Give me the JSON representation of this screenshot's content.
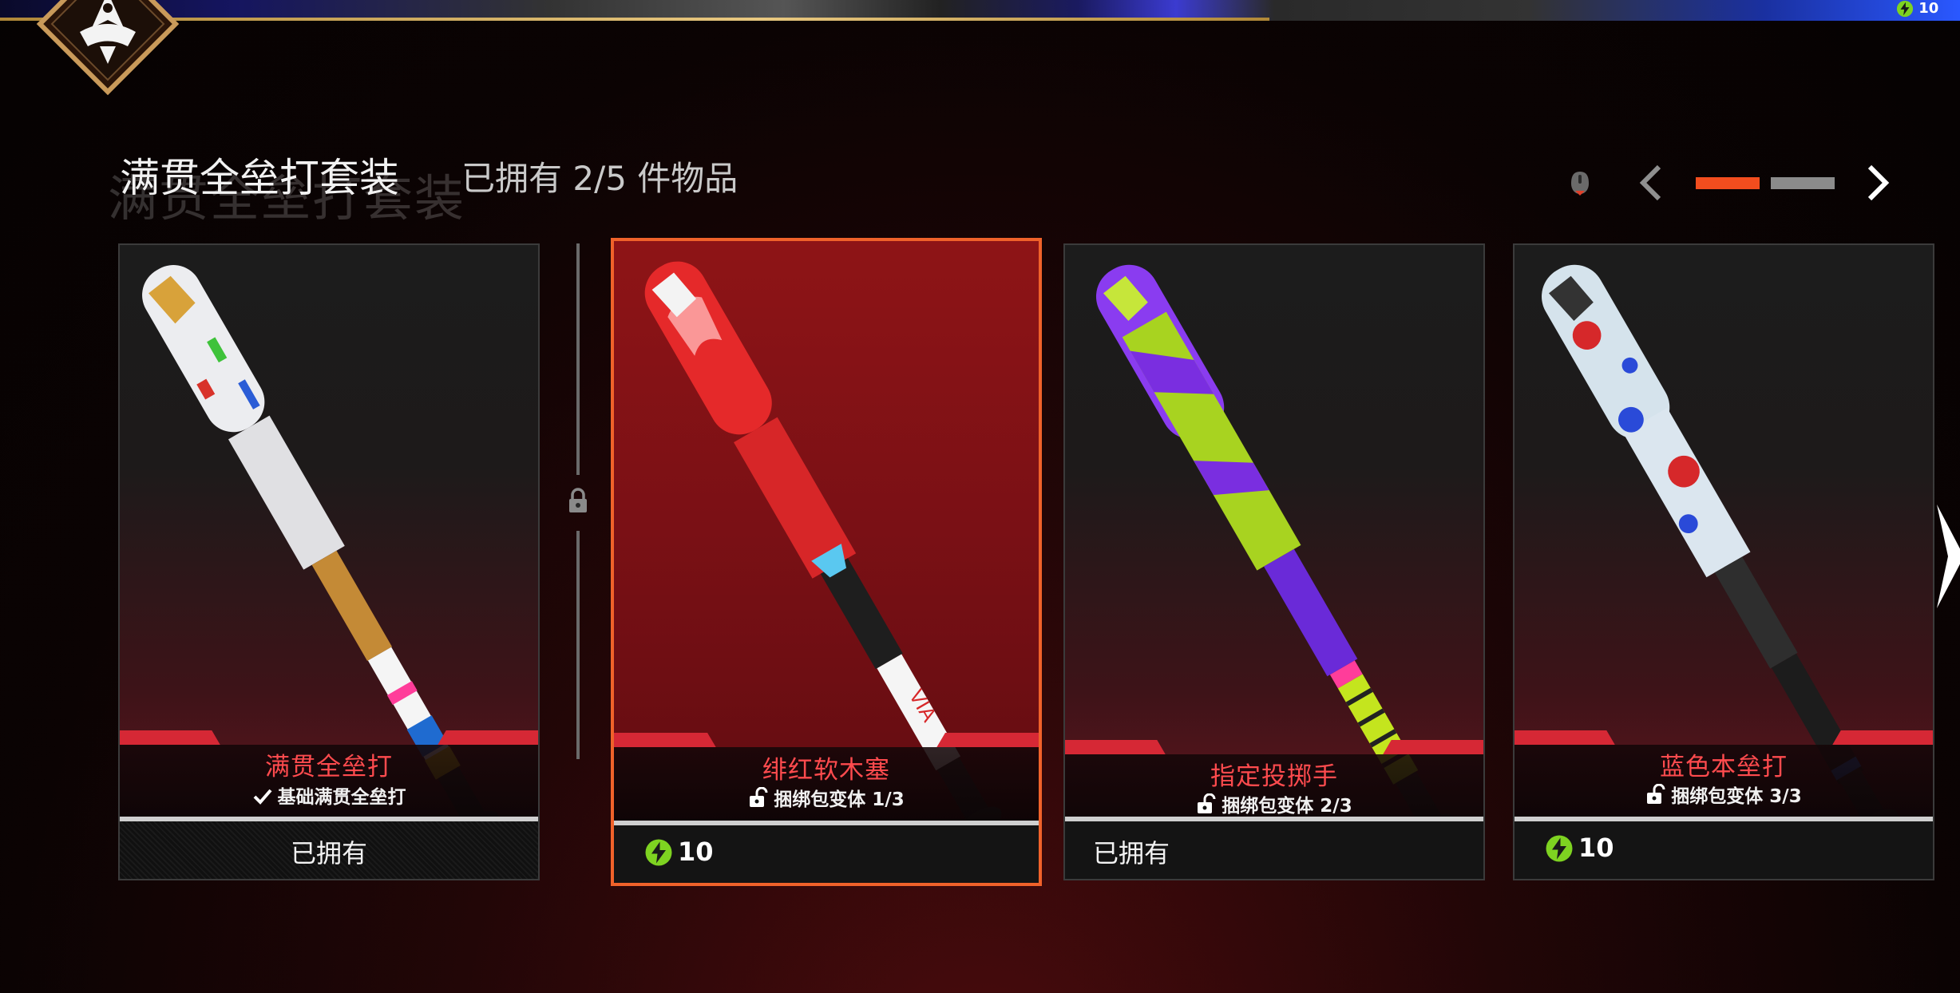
{
  "header": {
    "title_ghost": "满贯全垒打套装",
    "title": "满贯全垒打套装",
    "owned_count": "已拥有 2/5 件物品",
    "credits": "10"
  },
  "pager": {
    "pages": 2,
    "current": 1
  },
  "colors": {
    "accent": "#f24d1e",
    "item_name": "#ff4b4e",
    "currency": "#7ed321"
  },
  "cards": [
    {
      "name": "满贯全垒打",
      "subtitle": "基础满贯全垒打",
      "sub_icon": "check-icon",
      "status": "已拥有",
      "price": ""
    },
    {
      "name": "绯红软木塞",
      "subtitle": "捆绑包变体 1/3",
      "sub_icon": "unlock-icon",
      "status": "",
      "price": "10"
    },
    {
      "name": "指定投掷手",
      "subtitle": "捆绑包变体 2/3",
      "sub_icon": "unlock-icon",
      "status": "已拥有",
      "price": ""
    },
    {
      "name": "蓝色本垒打",
      "subtitle": "捆绑包变体 3/3",
      "sub_icon": "unlock-icon",
      "status": "",
      "price": "10"
    }
  ]
}
